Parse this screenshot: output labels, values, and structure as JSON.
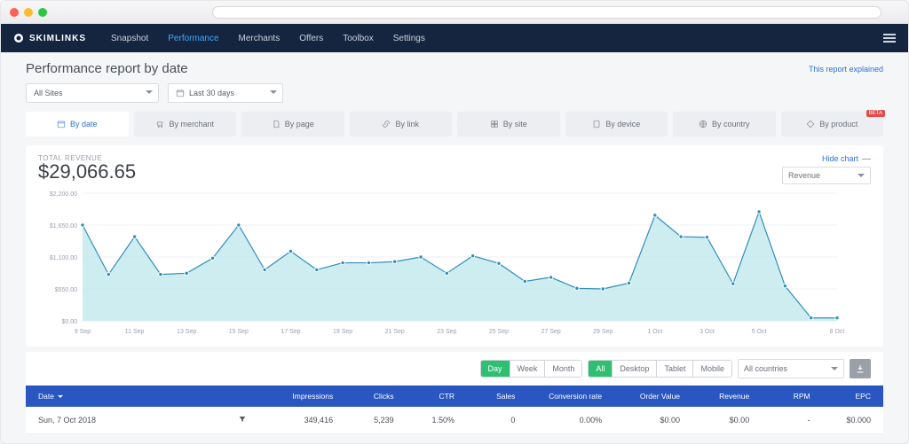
{
  "brand": "SKIMLINKS",
  "nav": {
    "items": [
      "Snapshot",
      "Performance",
      "Merchants",
      "Offers",
      "Toolbox",
      "Settings"
    ],
    "active": "Performance"
  },
  "page_title": "Performance report by date",
  "explain_link": "This report explained",
  "filters": {
    "site": "All Sites",
    "date_range": "Last 30 days"
  },
  "tabs": {
    "items": [
      {
        "label": "By date",
        "active": true
      },
      {
        "label": "By merchant"
      },
      {
        "label": "By page"
      },
      {
        "label": "By link"
      },
      {
        "label": "By site"
      },
      {
        "label": "By device"
      },
      {
        "label": "By country"
      },
      {
        "label": "By product",
        "beta": true
      }
    ]
  },
  "summary": {
    "label": "TOTAL REVENUE",
    "value": "$29,066.65"
  },
  "chart_controls": {
    "hide_label": "Hide chart",
    "metric": "Revenue"
  },
  "chart_data": {
    "type": "area",
    "title": "",
    "xlabel": "",
    "ylabel": "",
    "ylim": [
      0,
      2200
    ],
    "yticks": [
      "$0.00",
      "$550.00",
      "$1,100.00",
      "$1,650.00",
      "$2,200.00"
    ],
    "xticks": [
      "9 Sep",
      "11 Sep",
      "13 Sep",
      "15 Sep",
      "17 Sep",
      "19 Sep",
      "21 Sep",
      "23 Sep",
      "25 Sep",
      "27 Sep",
      "29 Sep",
      "1 Oct",
      "3 Oct",
      "5 Oct",
      "8 Oct"
    ],
    "categories": [
      "9 Sep",
      "10 Sep",
      "11 Sep",
      "12 Sep",
      "13 Sep",
      "14 Sep",
      "15 Sep",
      "16 Sep",
      "17 Sep",
      "18 Sep",
      "19 Sep",
      "20 Sep",
      "21 Sep",
      "22 Sep",
      "23 Sep",
      "24 Sep",
      "25 Sep",
      "26 Sep",
      "27 Sep",
      "28 Sep",
      "29 Sep",
      "30 Sep",
      "1 Oct",
      "2 Oct",
      "3 Oct",
      "4 Oct",
      "5 Oct",
      "6 Oct",
      "7 Oct",
      "8 Oct"
    ],
    "values": [
      1650,
      800,
      1450,
      800,
      820,
      1080,
      1650,
      880,
      1200,
      880,
      1000,
      1000,
      1020,
      1100,
      820,
      1120,
      990,
      680,
      750,
      560,
      550,
      650,
      1820,
      1450,
      1440,
      640,
      1880,
      600,
      50,
      50
    ]
  },
  "table_controls": {
    "granularity": {
      "options": [
        "Day",
        "Week",
        "Month"
      ],
      "active": "Day"
    },
    "device": {
      "options": [
        "All",
        "Desktop",
        "Tablet",
        "Mobile"
      ],
      "active": "All"
    },
    "country": "All countries"
  },
  "table": {
    "columns": [
      "Date",
      "Impressions",
      "Clicks",
      "CTR",
      "Sales",
      "Conversion rate",
      "Order Value",
      "Revenue",
      "RPM",
      "EPC"
    ],
    "rows": [
      {
        "date": "Sun, 7 Oct 2018",
        "impressions": "349,416",
        "clicks": "5,239",
        "ctr": "1.50%",
        "sales": "0",
        "conversion": "0.00%",
        "order_value": "$0.00",
        "revenue": "$0.00",
        "rpm": "-",
        "epc": "$0.000"
      }
    ]
  },
  "beta_label": "BETA"
}
